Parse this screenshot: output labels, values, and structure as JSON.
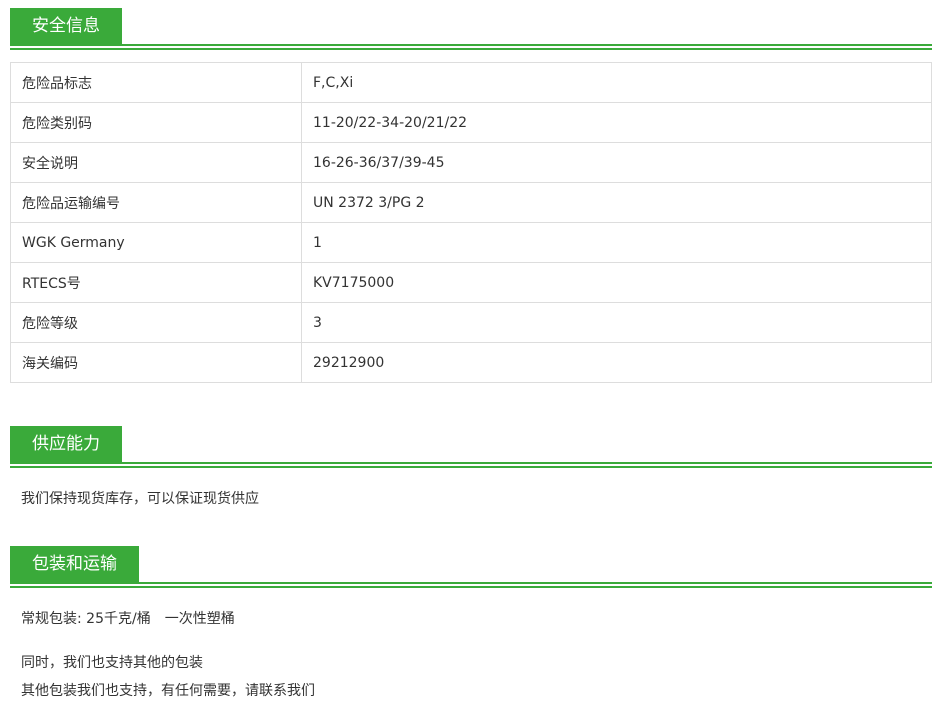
{
  "safety": {
    "heading": "安全信息",
    "rows": [
      {
        "label": "危险品标志",
        "value": "F,C,Xi"
      },
      {
        "label": "危险类别码",
        "value": "11-20/22-34-20/21/22"
      },
      {
        "label": "安全说明",
        "value": "16-26-36/37/39-45"
      },
      {
        "label": "危险品运输编号",
        "value": "UN 2372 3/PG 2"
      },
      {
        "label": "WGK Germany",
        "value": "1"
      },
      {
        "label": "RTECS号",
        "value": "KV7175000"
      },
      {
        "label": "危险等级",
        "value": "3"
      },
      {
        "label": "海关编码",
        "value": "29212900"
      }
    ]
  },
  "supply": {
    "heading": "供应能力",
    "text": "我们保持现货库存，可以保证现货供应"
  },
  "packaging": {
    "heading": "包装和运输",
    "line1": "常规包装: 25千克/桶　一次性塑桶",
    "line2": "同时，我们也支持其他的包装",
    "line3": "其他包装我们也支持，有任何需要，请联系我们"
  },
  "colors": {
    "accent": "#3aaa3a",
    "text": "#333333",
    "border": "#dddddd"
  }
}
